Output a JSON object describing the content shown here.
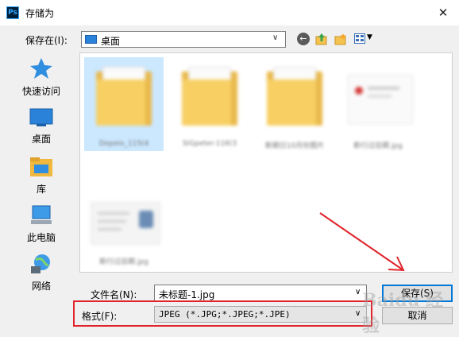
{
  "window": {
    "title": "存储为",
    "app_icon_text": "Ps",
    "close_glyph": "✕"
  },
  "toolbar": {
    "save_in_label": "保存在(I):",
    "save_in_value": "桌面",
    "dropdown_glyph": "∨",
    "back_glyph": "←"
  },
  "places": [
    {
      "label": "快速访问",
      "icon": "star-icon"
    },
    {
      "label": "桌面",
      "icon": "desktop-icon"
    },
    {
      "label": "库",
      "icon": "library-icon"
    },
    {
      "label": "此电脑",
      "icon": "computer-icon"
    },
    {
      "label": "网络",
      "icon": "network-icon"
    }
  ],
  "files": [
    {
      "name": "Dopeio_115(4",
      "type": "folder",
      "selected": true
    },
    {
      "name": "SiGpeter-116(3",
      "type": "folder"
    },
    {
      "name": "新期日10月份图片",
      "type": "folder"
    },
    {
      "name": "新行过目期.jpg",
      "type": "image"
    },
    {
      "name": "新行过目期.jpg",
      "type": "image"
    }
  ],
  "filename": {
    "label": "文件名(N):",
    "value": "未标题-1.jpg"
  },
  "format": {
    "label": "格式(F):",
    "value": "JPEG (*.JPG;*.JPEG;*.JPE)"
  },
  "buttons": {
    "save": "保存(S)",
    "cancel": "取消"
  },
  "watermark": "Baidu 经验",
  "colors": {
    "annotation": "#e0242c",
    "accent": "#0078d7"
  }
}
